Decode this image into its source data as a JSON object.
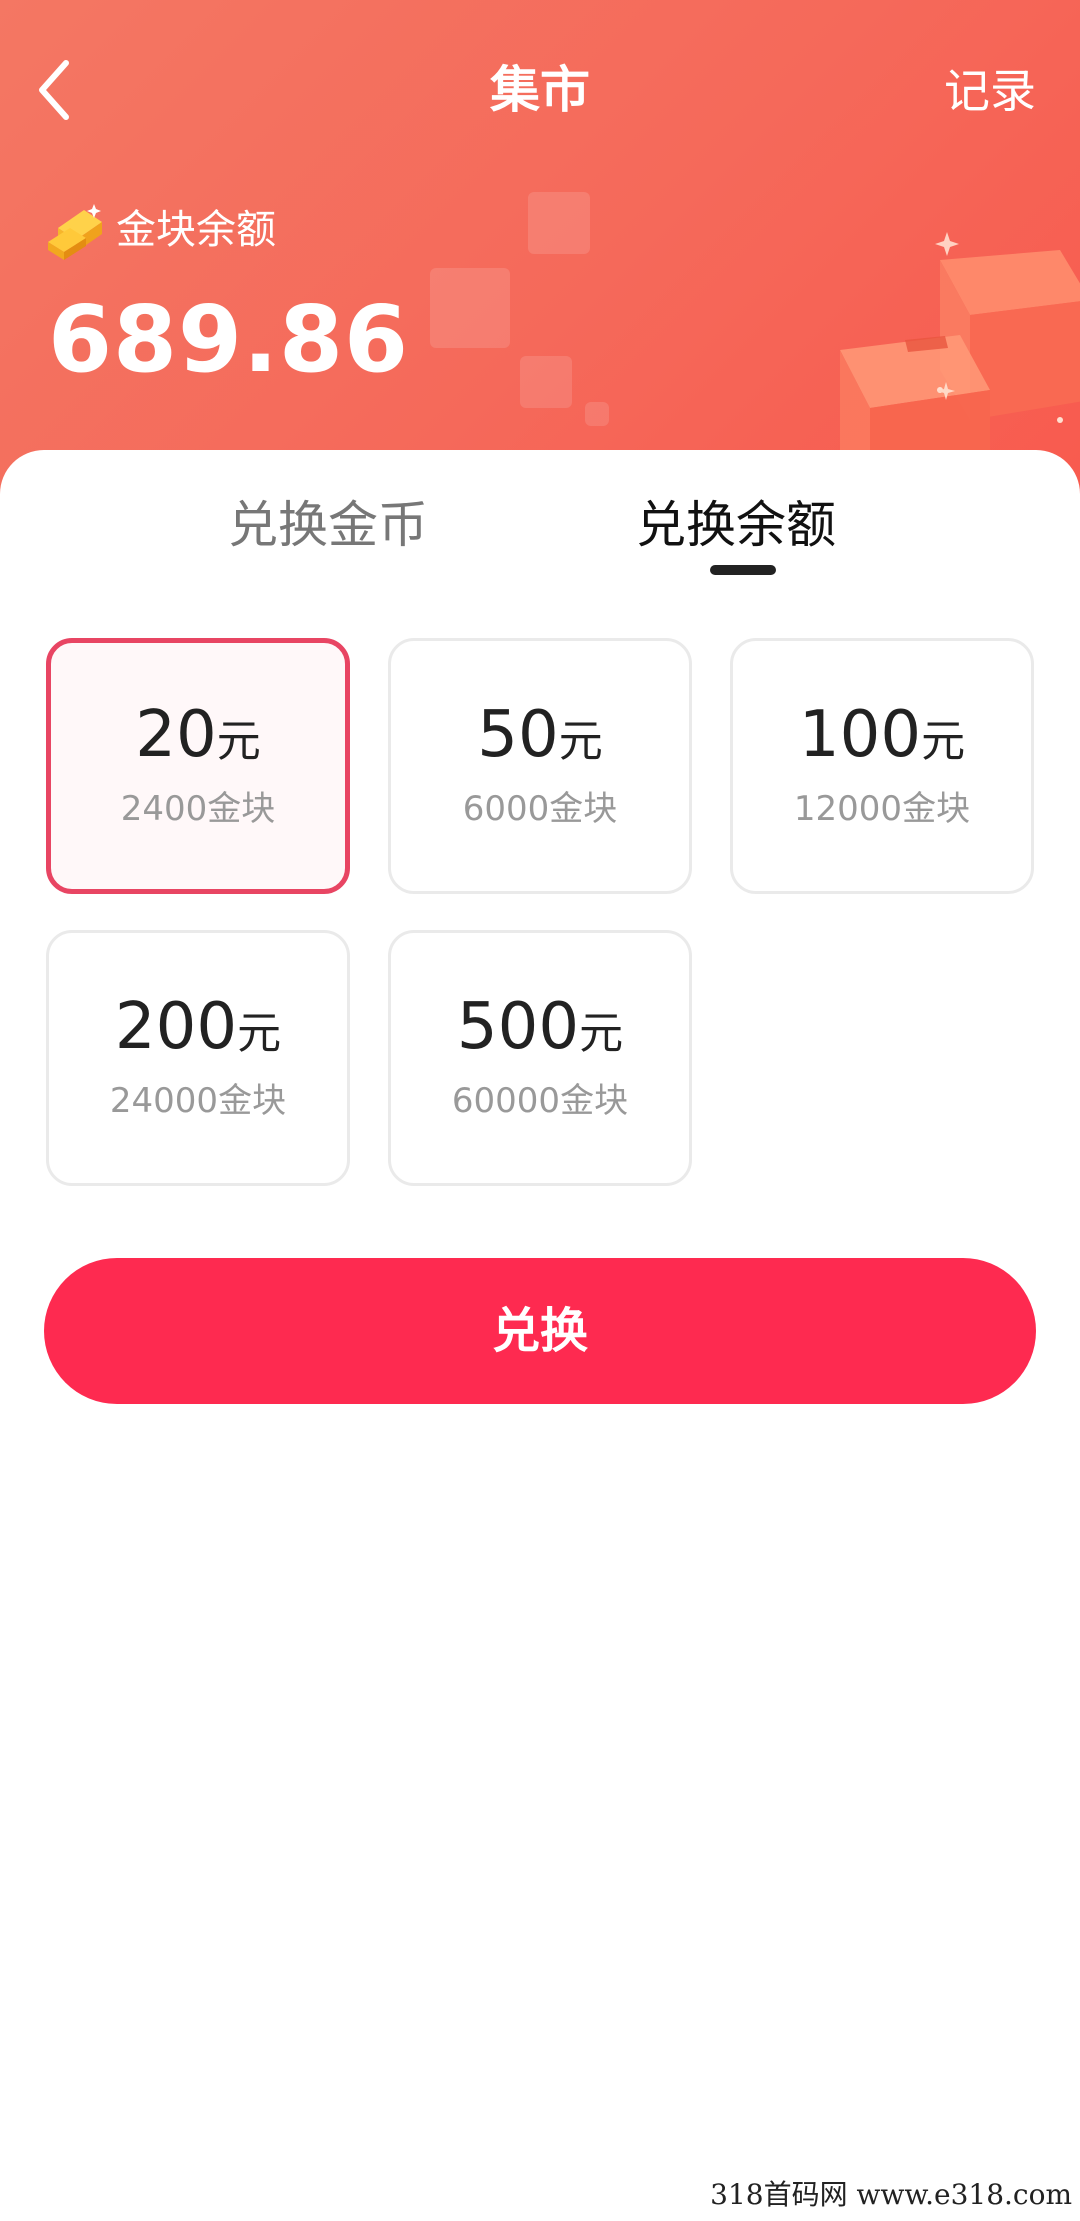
{
  "nav": {
    "title": "集市",
    "record_label": "记录"
  },
  "balance": {
    "label": "金块余额",
    "value": "689.86"
  },
  "tabs": [
    {
      "label": "兑换金币",
      "active": false
    },
    {
      "label": "兑换余额",
      "active": true
    }
  ],
  "options": [
    {
      "amount": "20",
      "unit": "元",
      "coins": "2400金块",
      "selected": true
    },
    {
      "amount": "50",
      "unit": "元",
      "coins": "6000金块",
      "selected": false
    },
    {
      "amount": "100",
      "unit": "元",
      "coins": "12000金块",
      "selected": false
    },
    {
      "amount": "200",
      "unit": "元",
      "coins": "24000金块",
      "selected": false
    },
    {
      "amount": "500",
      "unit": "元",
      "coins": "60000金块",
      "selected": false
    }
  ],
  "exchange_button": "兑换",
  "watermark": "318首码网 www.e318.com",
  "colors": {
    "header_gradient_start": "#f47763",
    "header_gradient_end": "#f85a4e",
    "accent": "#fe2a50",
    "selected_border": "#e84563"
  },
  "icons": {
    "back": "chevron-left-icon",
    "balance": "gold-bar-icon"
  }
}
